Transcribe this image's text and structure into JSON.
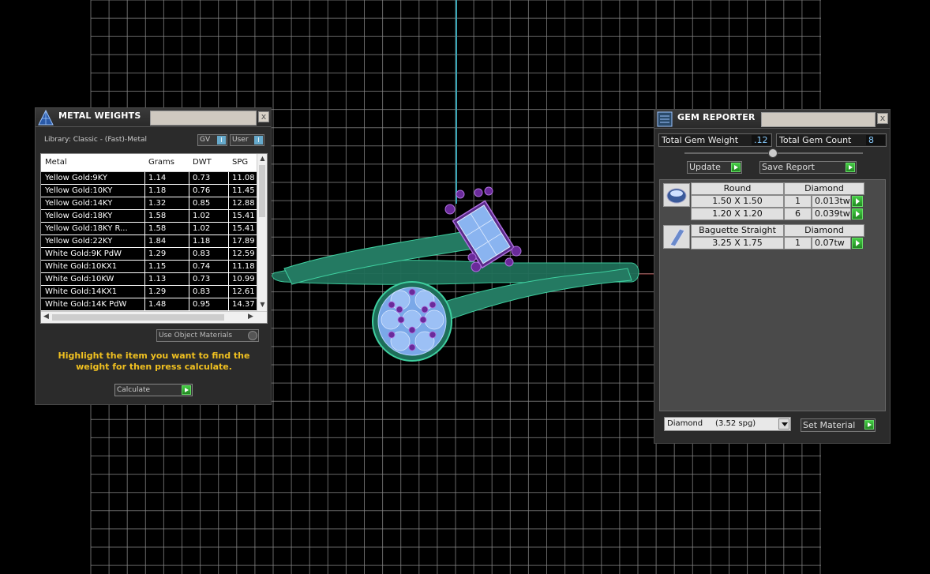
{
  "metal_weights": {
    "title": "METAL WEIGHTS",
    "close": "x",
    "library_label": "Library: Classic - (Fast)-Metal",
    "toggle_gv": "GV",
    "toggle_user": "User",
    "toggle_mark": "I",
    "columns": [
      "Metal",
      "Grams",
      "DWT",
      "SPG"
    ],
    "rows": [
      [
        "Yellow Gold:9KY",
        "1.14",
        "0.73",
        "11.08"
      ],
      [
        "Yellow Gold:10KY",
        "1.18",
        "0.76",
        "11.45"
      ],
      [
        "Yellow Gold:14KY",
        "1.32",
        "0.85",
        "12.88"
      ],
      [
        "Yellow Gold:18KY",
        "1.58",
        "1.02",
        "15.41"
      ],
      [
        "Yellow Gold:18KY R...",
        "1.58",
        "1.02",
        "15.41"
      ],
      [
        "Yellow Gold:22KY",
        "1.84",
        "1.18",
        "17.89"
      ],
      [
        "White Gold:9K PdW",
        "1.29",
        "0.83",
        "12.59"
      ],
      [
        "White Gold:10KX1",
        "1.15",
        "0.74",
        "11.18"
      ],
      [
        "White Gold:10KW",
        "1.13",
        "0.73",
        "10.99"
      ],
      [
        "White Gold:14KX1",
        "1.29",
        "0.83",
        "12.61"
      ],
      [
        "White Gold:14K PdW",
        "1.48",
        "0.95",
        "14.37"
      ]
    ],
    "use_object_materials_label": "Use Object Materials",
    "hint": "Highlight the item you want to find the weight for then press calculate.",
    "calculate_label": "Calculate"
  },
  "gem_reporter": {
    "title": "GEM REPORTER",
    "close": "x",
    "total_weight_label": "Total Gem Weight",
    "total_weight_value": ".12",
    "total_count_label": "Total Gem Count",
    "total_count_value": "8",
    "update_label": "Update",
    "save_report_label": "Save Report",
    "groups": [
      {
        "shape_icon": "round-gem-icon",
        "shape": "Round",
        "material": "Diamond",
        "sizes": [
          {
            "size": "1.50 X 1.50",
            "count": "1",
            "weight": "0.013tw"
          },
          {
            "size": "1.20 X 1.20",
            "count": "6",
            "weight": "0.039tw"
          }
        ]
      },
      {
        "shape_icon": "baguette-gem-icon",
        "shape": "Baguette Straight",
        "material": "Diamond",
        "sizes": [
          {
            "size": "3.25 X 1.75",
            "count": "1",
            "weight": "0.07tw"
          }
        ]
      }
    ],
    "material_select": "Diamond     (3.52 spg)",
    "set_material_label": "Set Material"
  },
  "colors": {
    "grid": "#8a8a8a",
    "ring_metal": "#2a8a6e",
    "gem_blue": "#8ab4f0",
    "prong_purple": "#7a2aa0",
    "axis_cyan": "#3aa8b8",
    "hint_yellow": "#f0c020"
  }
}
